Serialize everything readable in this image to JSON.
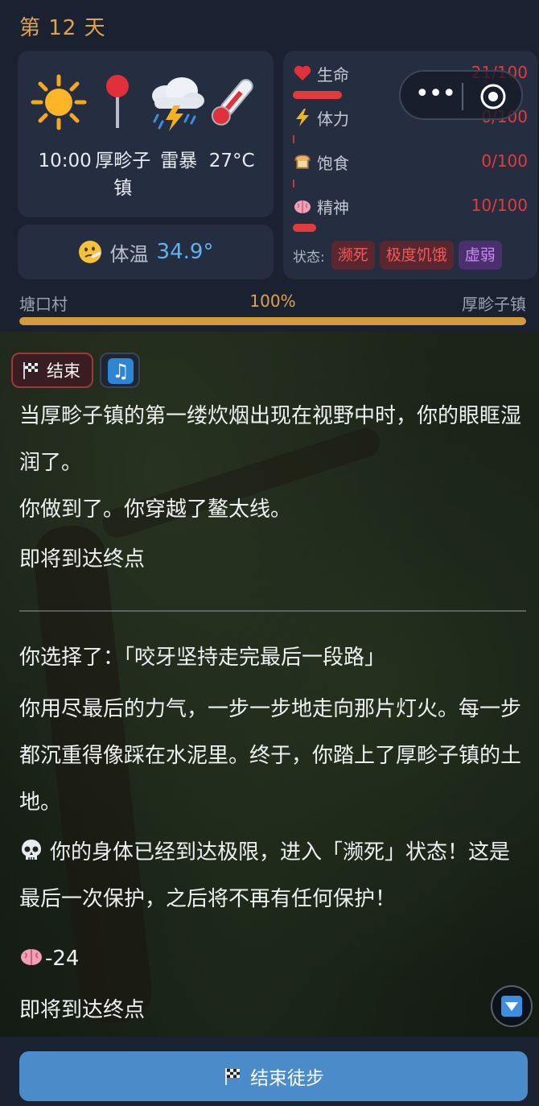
{
  "header": {
    "day_title": "第 12 天",
    "weather": {
      "icons": [
        "sun-icon",
        "location-pin-icon",
        "thunderstorm-icon",
        "thermometer-icon"
      ],
      "time": "10:00",
      "location": "厚畛子镇",
      "condition": "雷暴",
      "temperature": "27°C"
    },
    "body_temp": {
      "icon": "sick-face-icon",
      "label": "体温",
      "value": "34.9°"
    },
    "stats": [
      {
        "icon": "heart-icon",
        "name": "生命",
        "value": "21/100",
        "fraction": 0.21
      },
      {
        "icon": "lightning-icon",
        "name": "体力",
        "value": "0/100",
        "fraction": 0
      },
      {
        "icon": "bread-icon",
        "name": "饱食",
        "value": "0/100",
        "fraction": 0
      },
      {
        "icon": "brain-icon",
        "name": "精神",
        "value": "10/100",
        "fraction": 0.1
      }
    ],
    "status": {
      "label": "状态:",
      "badges": [
        {
          "text": "濒死",
          "tone": "red"
        },
        {
          "text": "极度饥饿",
          "tone": "red"
        },
        {
          "text": "虚弱",
          "tone": "purple"
        }
      ]
    },
    "journey": {
      "start": "塘口村",
      "percent": "100%",
      "end": "厚畛子镇",
      "fraction": 1.0
    }
  },
  "capsule": {
    "more_icon": "more-dots-icon",
    "close_icon": "target-icon"
  },
  "story": {
    "end_chip": "结束",
    "music_icon": "music-note-icon",
    "paragraphs": [
      "当厚畛子镇的第一缕炊烟出现在视野中时，你的眼眶湿润了。",
      "你做到了。你穿越了鳌太线。",
      "即将到达终点",
      "你选择了：「咬牙坚持走完最后一段路」",
      "你用尽最后的力气，一步一步地走向那片灯火。每一步都沉重得像踩在水泥里。终于，你踏上了厚畛子镇的土地。",
      "你的身体已经到达极限，进入「濒死」状态！这是最后一次保护，之后将不再有任何保护！",
      "-24",
      "即将到达终点"
    ],
    "skull_icon": "skull-icon",
    "brain_icon": "brain-icon",
    "scroll_icon": "scroll-down-icon"
  },
  "footer": {
    "finish_label": "结束徒步",
    "finish_icon": "checkered-flag-icon"
  },
  "colors": {
    "accent": "#e0a34a",
    "danger": "#e23b3b",
    "info": "#5fb3f0",
    "button": "#4b8bca"
  }
}
